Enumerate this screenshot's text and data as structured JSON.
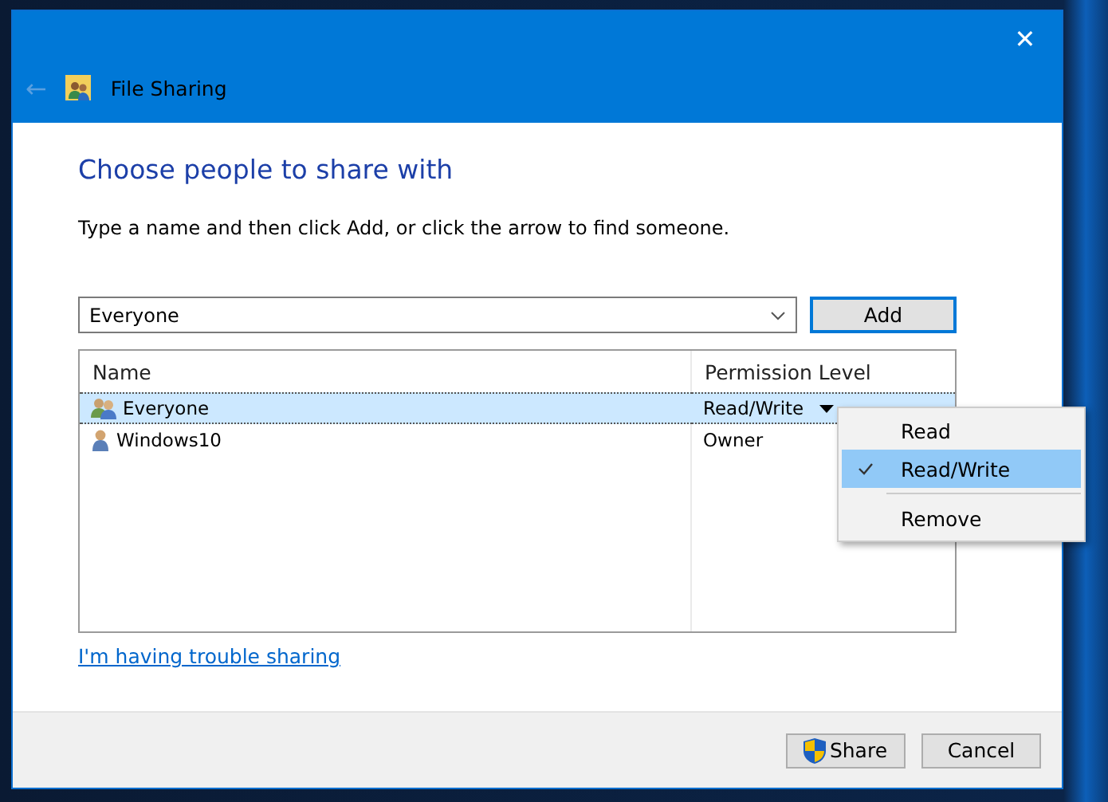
{
  "window": {
    "title": "File Sharing",
    "close": "✕",
    "back": "←"
  },
  "heading": "Choose people to share with",
  "instruction": "Type a name and then click Add, or click the arrow to find someone.",
  "name_field": {
    "value": "Everyone"
  },
  "add_button": "Add",
  "table": {
    "columns": [
      "Name",
      "Permission Level"
    ],
    "rows": [
      {
        "name": "Everyone",
        "kind": "group",
        "permission": "Read/Write",
        "selected": true
      },
      {
        "name": "Windows10",
        "kind": "user",
        "permission": "Owner",
        "selected": false
      }
    ]
  },
  "permission_menu": [
    {
      "label": "Read",
      "checked": false
    },
    {
      "label": "Read/Write",
      "checked": true
    },
    {
      "label": "Remove",
      "checked": false
    }
  ],
  "trouble_link": "I'm having trouble sharing",
  "buttons": [
    {
      "label": "Share",
      "kind": "shield"
    },
    {
      "label": "Cancel",
      "kind": "plain"
    }
  ]
}
